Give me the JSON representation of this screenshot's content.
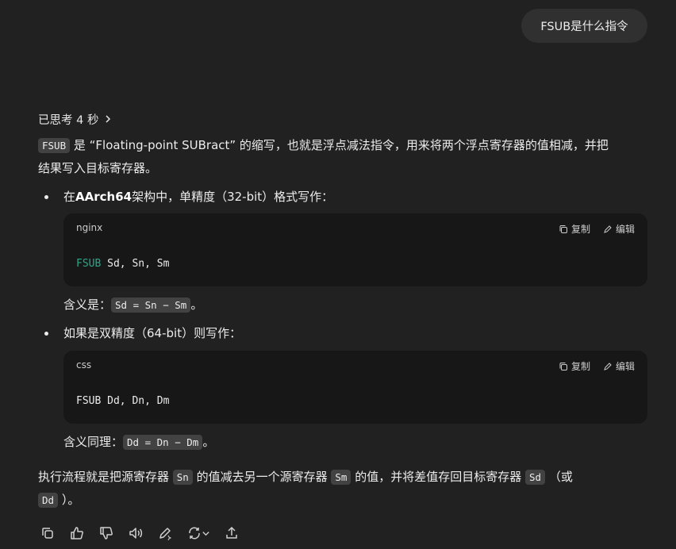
{
  "user_message": "FSUB是什么指令",
  "thinking_label": "已思考 4 秒",
  "intro": {
    "code": "FSUB",
    "text1": "是 “Floating-point SUBract” 的缩写，也就是浮点减法指令，用来将两个浮点寄存器的值相减，并把",
    "text2": "结果写入目标寄存器。"
  },
  "bullet1": {
    "prefix": "在 ",
    "bold": "AArch64",
    "suffix": " 架构中，单精度（32-bit）格式写作：",
    "code_lang": "nginx",
    "code_kw": "FSUB",
    "code_rest": " Sd, Sn, Sm",
    "meaning_label": "含义是：",
    "meaning_code": "Sd = Sn − Sm",
    "meaning_end": "。"
  },
  "bullet2": {
    "text": "如果是双精度（64-bit）则写作：",
    "code_lang": "css",
    "code_line": "FSUB Dd, Dn, Dm",
    "meaning_label": "含义同理：",
    "meaning_code": "Dd = Dn − Dm",
    "meaning_end": "。"
  },
  "code_actions": {
    "copy": "复制",
    "edit": "编辑"
  },
  "conclusion": {
    "t1": "执行流程就是把源寄存器 ",
    "c1": "Sn",
    "t2": " 的值减去另一个源寄存器 ",
    "c2": "Sm",
    "t3": " 的值，并将差值存回目标寄存器 ",
    "c3": "Sd",
    "t4": " （或",
    "c4": "Dd",
    "t5": " ）。"
  },
  "action_icons": [
    "copy-icon",
    "thumbs-up-icon",
    "thumbs-down-icon",
    "read-aloud-icon",
    "edit-icon",
    "regenerate-icon",
    "share-icon"
  ]
}
